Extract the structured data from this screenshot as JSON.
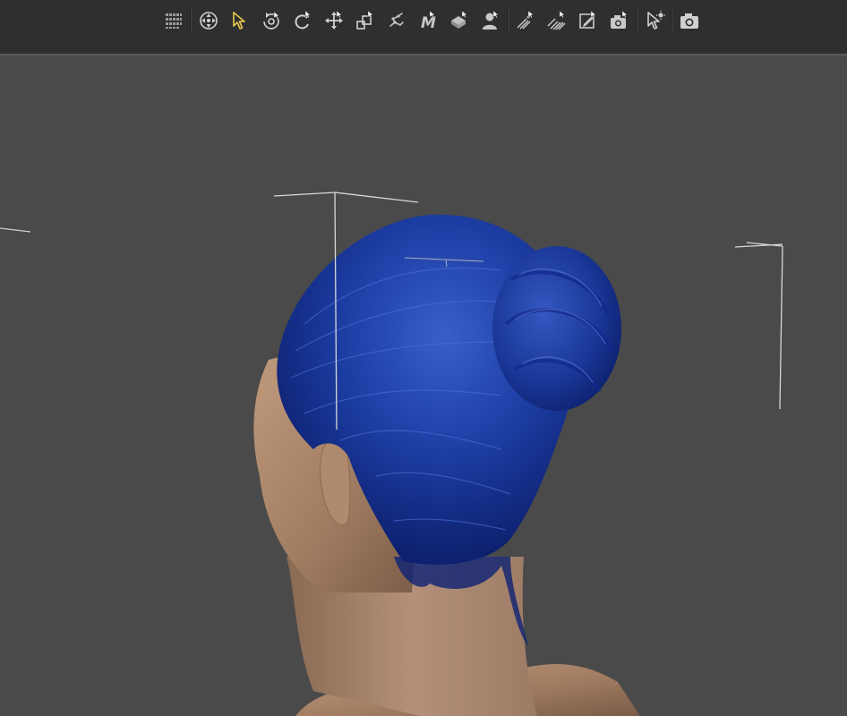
{
  "toolbar": {
    "tools": [
      {
        "id": "node-editor",
        "icon": "grid-dots-icon",
        "active": false
      },
      {
        "id": "universal",
        "icon": "universal-tool-icon",
        "active": false
      },
      {
        "id": "node-selection",
        "icon": "arrow-cursor-icon",
        "active": true
      },
      {
        "id": "orbit",
        "icon": "orbit-icon",
        "active": false
      },
      {
        "id": "rotate",
        "icon": "rotate-icon",
        "active": false
      },
      {
        "id": "translate",
        "icon": "translate-icon",
        "active": false
      },
      {
        "id": "scale",
        "icon": "scale-icon",
        "active": false
      },
      {
        "id": "joint-editor",
        "icon": "joint-editor-icon",
        "active": false
      },
      {
        "id": "geometry-editor",
        "icon": "geometry-editor-icon",
        "active": false
      },
      {
        "id": "surface-selection",
        "icon": "surface-selection-icon",
        "active": false
      },
      {
        "id": "figure-pose",
        "icon": "figure-pose-icon",
        "active": false
      },
      {
        "id": "edit-hair",
        "icon": "edit-hair-icon",
        "active": false
      },
      {
        "id": "brush-hair",
        "icon": "brush-hair-icon",
        "active": false
      },
      {
        "id": "edit-region",
        "icon": "edit-region-icon",
        "active": false
      },
      {
        "id": "camera-view",
        "icon": "camera-view-icon",
        "active": false
      },
      {
        "id": "spot-render",
        "icon": "spot-render-icon",
        "active": false
      },
      {
        "id": "camera",
        "icon": "camera-icon",
        "active": false
      }
    ],
    "accent_color": "#e8c84a",
    "icon_color": "#c8c8c8"
  },
  "viewport": {
    "background": "#4a4a4a",
    "hair_color": "#1a3aa8",
    "skin_color": "#b08a6e"
  }
}
